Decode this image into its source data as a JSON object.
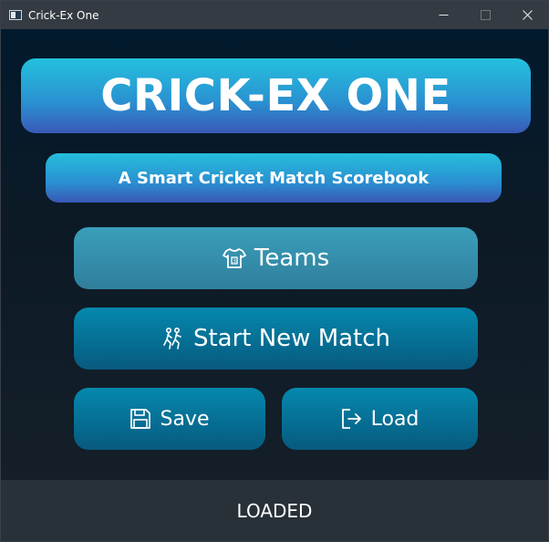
{
  "window": {
    "title": "Crick-Ex One"
  },
  "titlebar_controls": {
    "minimize_icon": "minimize-icon",
    "maximize_icon": "maximize-icon",
    "close_icon": "close-icon"
  },
  "header": {
    "title": "CRICK-EX ONE",
    "subtitle": "A Smart Cricket Match Scorebook"
  },
  "menu": {
    "teams": {
      "label": "Teams",
      "icon": "jersey-icon"
    },
    "start_new_match": {
      "label": "Start New Match",
      "icon": "players-running-icon"
    },
    "save": {
      "label": "Save",
      "icon": "floppy-disk-icon"
    },
    "load": {
      "label": "Load",
      "icon": "import-arrow-icon"
    }
  },
  "status": {
    "text": "LOADED"
  },
  "colors": {
    "banner_top": "#24c1de",
    "banner_bottom": "#3a59b8",
    "teams_button": "#3a9fbb",
    "primary_button": "#0588ae",
    "status_bar": "#283038"
  }
}
